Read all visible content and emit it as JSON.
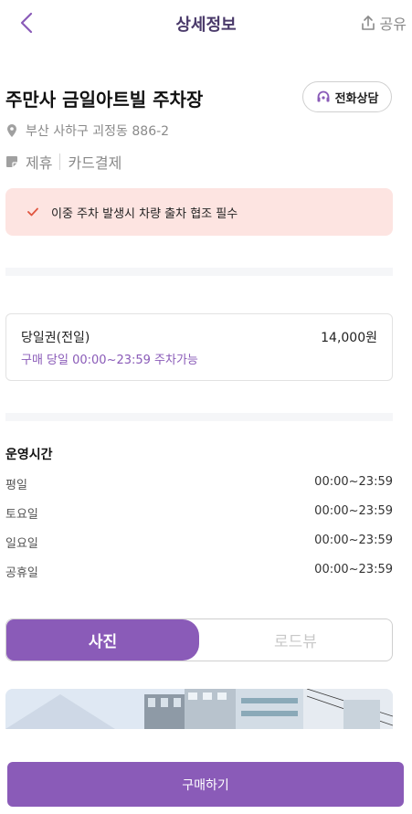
{
  "header": {
    "title": "상세정보",
    "share_label": "공유"
  },
  "place": {
    "name": "주만사 금일아트빌 주차장",
    "call_label": "전화상담",
    "address": "부산 사하구 괴정동 886-2",
    "tags": [
      "제휴",
      "카드결제"
    ]
  },
  "notice": {
    "text": "이중 주차 발생시 차량 출차 협조 필수"
  },
  "ticket": {
    "name": "당일권(전일)",
    "price": "14,000원",
    "description": "구매 당일 00:00~23:59 주차가능"
  },
  "hours": {
    "title": "운영시간",
    "rows": [
      {
        "day": "평일",
        "time": "00:00~23:59"
      },
      {
        "day": "토요일",
        "time": "00:00~23:59"
      },
      {
        "day": "일요일",
        "time": "00:00~23:59"
      },
      {
        "day": "공휴일",
        "time": "00:00~23:59"
      }
    ]
  },
  "media_tabs": {
    "photo_label": "사진",
    "roadview_label": "로드뷰",
    "selected": "사진"
  },
  "buy": {
    "label": "구매하기"
  },
  "colors": {
    "accent": "#8a5bb8",
    "notice_bg": "#fde4e1",
    "notice_check": "#e0553f"
  }
}
